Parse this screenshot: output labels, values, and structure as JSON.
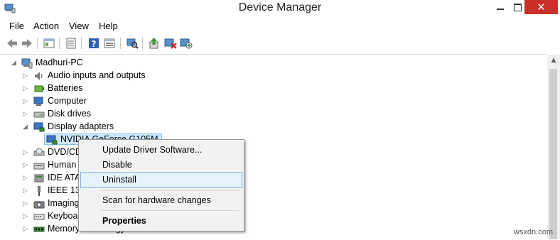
{
  "window": {
    "title": "Device Manager",
    "close_glyph": "✕"
  },
  "menu": [
    "File",
    "Action",
    "View",
    "Help"
  ],
  "toolbar_icons": [
    "back-arrow-icon",
    "forward-arrow-icon",
    "show-hide-tree-icon",
    "properties-icon",
    "help-icon",
    "show-hidden-icon",
    "scan-hardware-changes-icon",
    "update-driver-icon",
    "disable-device-icon",
    "uninstall-device-icon"
  ],
  "tree": {
    "root": "Madhuri-PC",
    "items": [
      {
        "label": "Audio inputs and outputs",
        "expander": "▷",
        "icon": "speaker-icon"
      },
      {
        "label": "Batteries",
        "expander": "▷",
        "icon": "battery-icon"
      },
      {
        "label": "Computer",
        "expander": "▷",
        "icon": "computer-icon"
      },
      {
        "label": "Disk drives",
        "expander": "▷",
        "icon": "disk-drive-icon"
      },
      {
        "label": "Display adapters",
        "expander": "◢",
        "icon": "display-adapter-icon"
      },
      {
        "label": "NVIDIA GeForce G105M",
        "expander": "",
        "icon": "display-adapter-icon"
      },
      {
        "label": "DVD/CD",
        "expander": "▷",
        "icon": "dvd-drive-icon"
      },
      {
        "label": "Human",
        "expander": "▷",
        "icon": "hid-icon"
      },
      {
        "label": "IDE ATA",
        "expander": "▷",
        "icon": "ide-controller-icon"
      },
      {
        "label": "IEEE 139",
        "expander": "▷",
        "icon": "ieee1394-icon"
      },
      {
        "label": "Imaging",
        "expander": "▷",
        "icon": "camera-icon"
      },
      {
        "label": "Keyboar",
        "expander": "▷",
        "icon": "keyboard-icon"
      },
      {
        "label": "Memory technology devices",
        "expander": "▷",
        "icon": "memory-icon"
      }
    ]
  },
  "context_menu": {
    "items": [
      {
        "label": "Update Driver Software...",
        "bold": false
      },
      {
        "label": "Disable",
        "bold": false
      },
      {
        "label": "Uninstall",
        "bold": false,
        "highlighted": true
      },
      {
        "label": "Scan for hardware changes",
        "bold": false
      },
      {
        "label": "Properties",
        "bold": true
      }
    ]
  },
  "scrollbar": {
    "up_glyph": "▲"
  },
  "watermark": "wsxdn.com",
  "colors": {
    "close": "#c7312a",
    "selection": "#cde6f7",
    "menu_highlight": "#e5f1fb"
  }
}
